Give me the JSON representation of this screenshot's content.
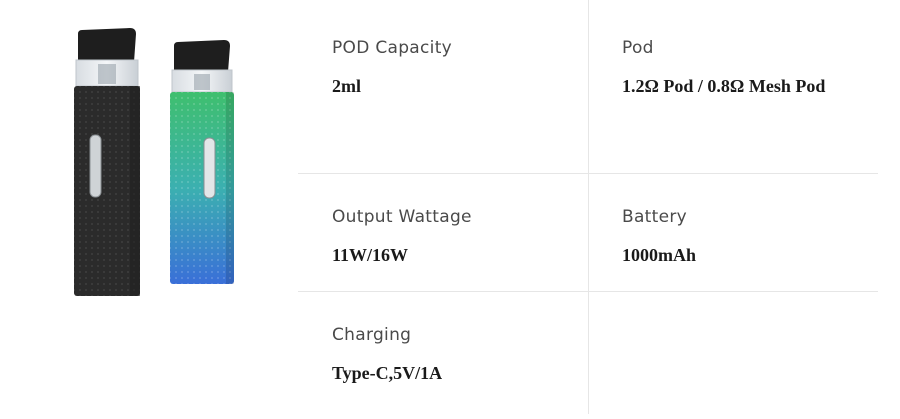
{
  "specs": [
    {
      "label": "POD Capacity",
      "value": "2ml"
    },
    {
      "label": "Pod",
      "value": "1.2Ω Pod / 0.8Ω Mesh Pod"
    },
    {
      "label": "Output Wattage",
      "value": "11W/16W"
    },
    {
      "label": "Battery",
      "value": "1000mAh"
    },
    {
      "label": "Charging",
      "value": "Type-C,5V/1A"
    }
  ],
  "colors": {
    "device_black": "#2b2b2b",
    "device_gradient_top": "#3fbf6e",
    "device_gradient_bottom": "#3a6fd8",
    "divider": "#e6e6e6"
  }
}
